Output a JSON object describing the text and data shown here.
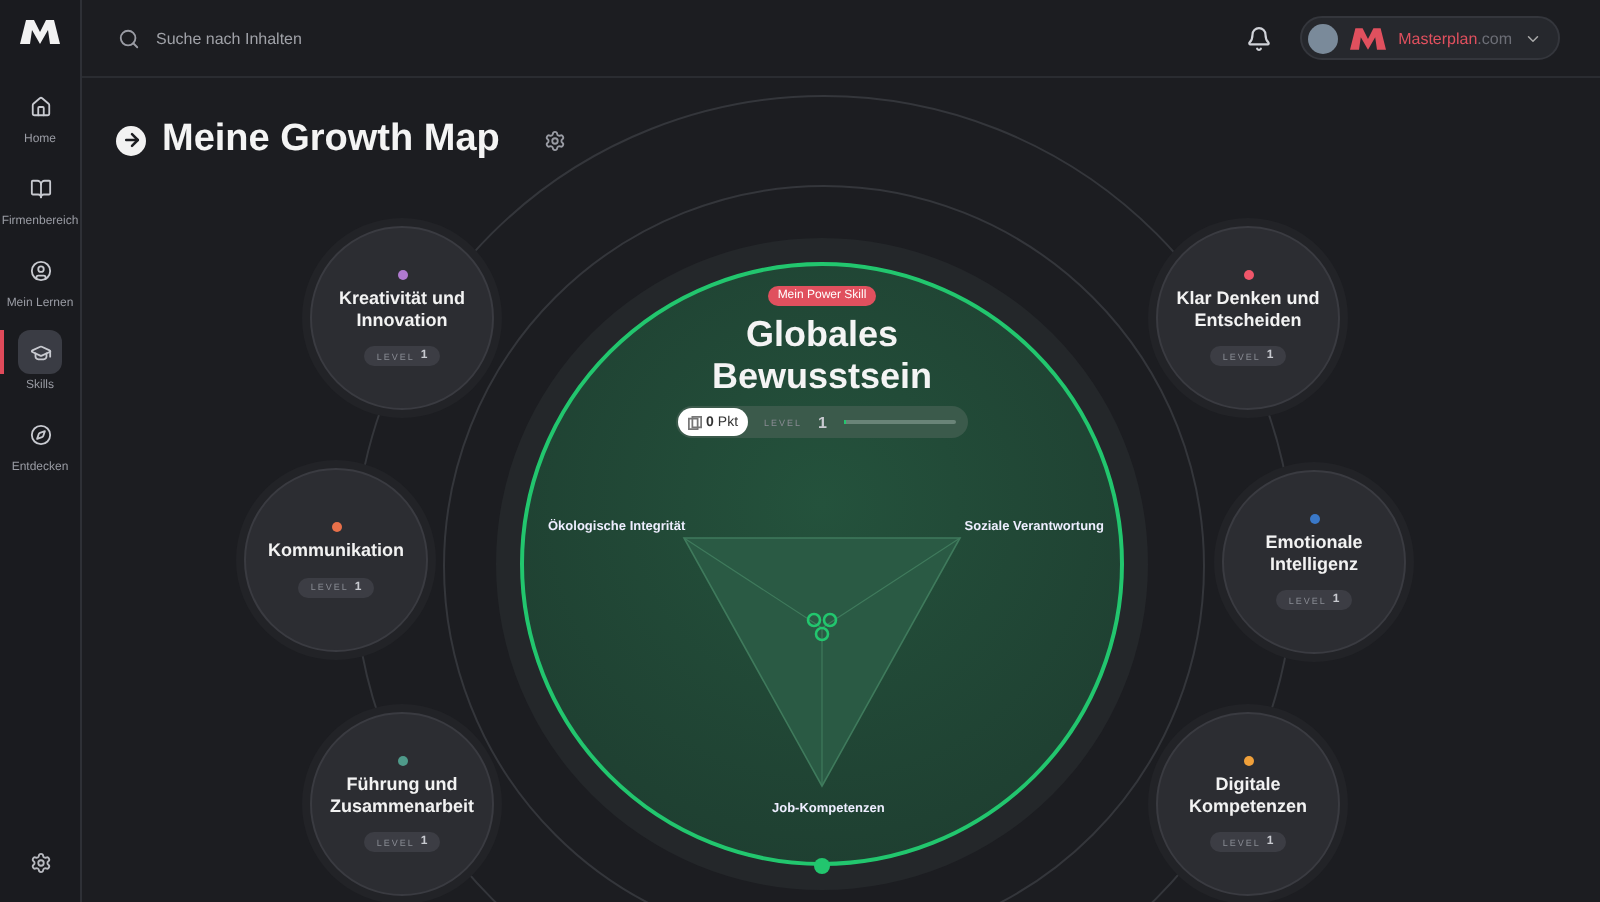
{
  "sidebar": {
    "items": [
      {
        "label": "Home",
        "kind": "home",
        "selected": false
      },
      {
        "label": "Firmenbereich",
        "kind": "book",
        "selected": false
      },
      {
        "label": "Mein Lernen",
        "kind": "user",
        "selected": false
      },
      {
        "label": "Skills",
        "kind": "cap",
        "selected": true
      },
      {
        "label": "Entdecken",
        "kind": "compass",
        "selected": false
      }
    ]
  },
  "search": {
    "placeholder": "Suche nach Inhalten"
  },
  "account": {
    "brand": "Masterplan",
    "domain": ".com"
  },
  "page": {
    "title": "Meine Growth Map"
  },
  "power_skill": {
    "badge": "Mein Power Skill",
    "title": "Globales Bewusstsein",
    "points": "0",
    "points_unit": "Pkt",
    "level_label": "LEVEL",
    "level_value": "1",
    "level": 0.03,
    "axes": [
      "Ökologische Integrität",
      "Soziale Verantwortung",
      "Job-Kompetenzen"
    ]
  },
  "skills": [
    {
      "name": "Kreativität und Innovation",
      "color": "#b07ad0",
      "level_label": "LEVEL",
      "level_value": "1"
    },
    {
      "name": "Kommunikation",
      "color": "#e8704a",
      "level_label": "LEVEL",
      "level_value": "1"
    },
    {
      "name": "Führung und Zusammenarbeit",
      "color": "#4f9a8a",
      "level_label": "LEVEL",
      "level_value": "1"
    },
    {
      "name": "Klar Denken und Entscheiden",
      "color": "#f0566a",
      "level_label": "LEVEL",
      "level_value": "1"
    },
    {
      "name": "Emotionale Intelligenz",
      "color": "#3a78c8",
      "level_label": "LEVEL",
      "level_value": "1"
    },
    {
      "name": "Digitale Kompetenzen",
      "color": "#f0a03a",
      "level_label": "LEVEL",
      "level_value": "1"
    }
  ]
}
